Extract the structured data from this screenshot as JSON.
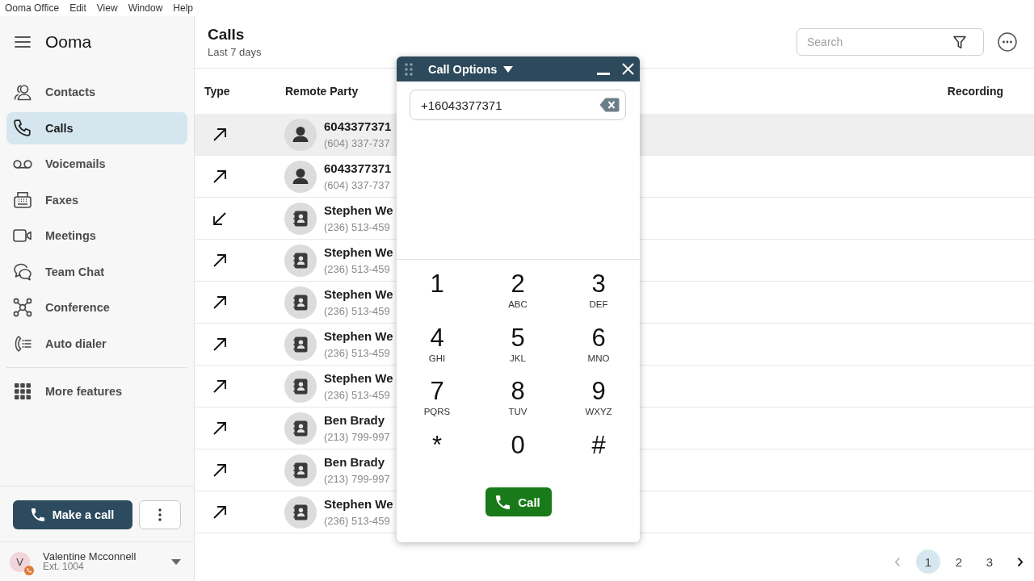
{
  "menu_bar": [
    "Ooma Office",
    "Edit",
    "View",
    "Window",
    "Help"
  ],
  "sidebar": {
    "logo": "Ooma",
    "items": [
      {
        "label": "Contacts",
        "selected": false
      },
      {
        "label": "Calls",
        "selected": true
      },
      {
        "label": "Voicemails",
        "selected": false
      },
      {
        "label": "Faxes",
        "selected": false
      },
      {
        "label": "Meetings",
        "selected": false
      },
      {
        "label": "Team Chat",
        "selected": false
      },
      {
        "label": "Conference",
        "selected": false
      },
      {
        "label": "Auto dialer",
        "selected": false
      }
    ],
    "more_features": "More features",
    "make_call_button": "Make a call",
    "user": {
      "initial": "V",
      "name": "Valentine Mcconnell",
      "extension": "Ext. 1004"
    }
  },
  "header": {
    "title": "Calls",
    "subtitle": "Last 7 days",
    "search": {
      "placeholder": "Search"
    }
  },
  "table": {
    "columns": [
      "Type",
      "Remote Party",
      "Recording"
    ],
    "rows": [
      {
        "type_icon": {
          "kind": "outgoing"
        },
        "avatar": {
          "kind": "unknown"
        },
        "name": "6043377371",
        "phone": "(604) 337-737",
        "selected": true
      },
      {
        "type_icon": {
          "kind": "outgoing"
        },
        "avatar": {
          "kind": "unknown"
        },
        "name": "6043377371",
        "phone": "(604) 337-737",
        "selected": false
      },
      {
        "type_icon": {
          "kind": "incoming"
        },
        "avatar": {
          "kind": "contact"
        },
        "name": "Stephen We",
        "phone": "(236) 513-459",
        "selected": false
      },
      {
        "type_icon": {
          "kind": "outgoing"
        },
        "avatar": {
          "kind": "contact"
        },
        "name": "Stephen We",
        "phone": "(236) 513-459",
        "selected": false
      },
      {
        "type_icon": {
          "kind": "outgoing"
        },
        "avatar": {
          "kind": "contact"
        },
        "name": "Stephen We",
        "phone": "(236) 513-459",
        "selected": false
      },
      {
        "type_icon": {
          "kind": "outgoing"
        },
        "avatar": {
          "kind": "contact"
        },
        "name": "Stephen We",
        "phone": "(236) 513-459",
        "selected": false
      },
      {
        "type_icon": {
          "kind": "outgoing"
        },
        "avatar": {
          "kind": "contact"
        },
        "name": "Stephen We",
        "phone": "(236) 513-459",
        "selected": false
      },
      {
        "type_icon": {
          "kind": "outgoing"
        },
        "avatar": {
          "kind": "contact"
        },
        "name": "Ben Brady",
        "phone": "(213) 799-997",
        "selected": false
      },
      {
        "type_icon": {
          "kind": "outgoing"
        },
        "avatar": {
          "kind": "contact"
        },
        "name": "Ben Brady",
        "phone": "(213) 799-997",
        "selected": false
      },
      {
        "type_icon": {
          "kind": "outgoing"
        },
        "avatar": {
          "kind": "contact"
        },
        "name": "Stephen We",
        "phone": "(236) 513-459",
        "selected": false
      }
    ]
  },
  "pagination": {
    "previous": {
      "disabled": true
    },
    "next": {
      "disabled": false
    },
    "pages": [
      {
        "label": "1",
        "selected": true
      },
      {
        "label": "2",
        "selected": false
      },
      {
        "label": "3",
        "selected": false
      }
    ]
  },
  "dialog": {
    "title": "Call Options",
    "number": "+16043377371",
    "keys": [
      {
        "digit": "1"
      },
      {
        "digit": "2",
        "letters": "ABC"
      },
      {
        "digit": "3",
        "letters": "DEF"
      },
      {
        "digit": "4",
        "letters": "GHI"
      },
      {
        "digit": "5",
        "letters": "JKL"
      },
      {
        "digit": "6",
        "letters": "MNO"
      },
      {
        "digit": "7",
        "letters": "PQRS"
      },
      {
        "digit": "8",
        "letters": "TUV"
      },
      {
        "digit": "9",
        "letters": "WXYZ"
      },
      {
        "digit": "*"
      },
      {
        "digit": "0"
      },
      {
        "digit": "#"
      }
    ],
    "call_button": "Call"
  }
}
